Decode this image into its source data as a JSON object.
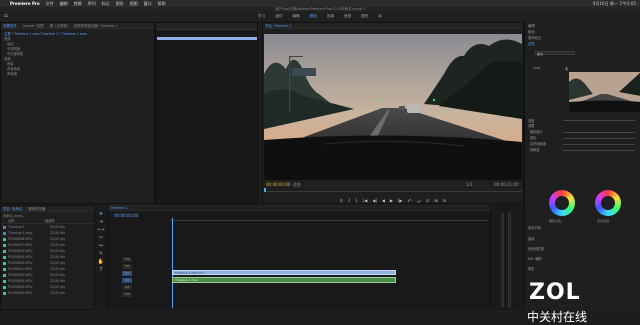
{
  "menubar": {
    "apple": "",
    "app_name": "Premiere Pro",
    "items": [
      "文件",
      "编辑",
      "剪辑",
      "序列",
      "标记",
      "图形",
      "视图",
      "窗口",
      "帮助"
    ],
    "status_right": "9月16日 周一 下午5:05"
  },
  "title_path": "/用户/zol/文稿/Adobe/Premiere Pro/13.0/未命名.prproj *",
  "workspaces": [
    "学习",
    "组件",
    "编辑",
    "颜色",
    "效果",
    "音频",
    "图形",
    "库"
  ],
  "workspace_active": 3,
  "source_panel": {
    "tabs": [
      "效果控件",
      "Lumetri 范围",
      "源: (无剪辑)",
      "音频剪辑混合器: Timeline 1"
    ],
    "rows": [
      "主要 * Timeline 1.mov  Timeline 1 * Timeline 1.mov",
      "视频",
      "运动",
      "不透明度",
      "时间重映射",
      "音频",
      "音量",
      "声道音量",
      "声像器"
    ]
  },
  "program": {
    "tab": "节目: Timeline 1",
    "timecode_left": "00:00:00:00",
    "fit": "适合",
    "quality": "1/2",
    "timecode_right": "00:00:21:00"
  },
  "controls": [
    "⚲",
    "{",
    "}",
    "|◀",
    "◀|",
    "◀",
    "▶",
    "|▶",
    "⤺",
    "⤻",
    "⊡",
    "⊞",
    "⊟"
  ],
  "lumetri": {
    "tabs": [
      "编辑",
      "颜色"
    ],
    "rows": [
      "基本校正",
      "创意",
      "曲线",
      "色轮和匹配",
      "HSL 辅助",
      "晕影"
    ],
    "preset_label": "Look",
    "preset_value": "无",
    "sliders": [
      "强度",
      "调整",
      "褪色胶片",
      "锐化",
      "自然饱和度",
      "饱和度"
    ],
    "wheel_labels": [
      "阴影淡色",
      "高光色调"
    ],
    "balance_label": "色彩平衡"
  },
  "project": {
    "tabs": [
      "项目: 未命名",
      "媒体浏览器"
    ],
    "path": "未命名.prproj",
    "columns": [
      "名称",
      "帧速率"
    ],
    "items": [
      {
        "name": "Timeline 1",
        "rate": "25.00 fps"
      },
      {
        "name": "Timeline 1.mov",
        "rate": "25.00 fps"
      },
      {
        "name": "P1000836.MOV",
        "rate": "25.00 fps"
      },
      {
        "name": "P1000837.MOV",
        "rate": "25.00 fps"
      },
      {
        "name": "P1000838.MOV",
        "rate": "25.00 fps"
      },
      {
        "name": "P1000839.MOV",
        "rate": "25.00 fps"
      },
      {
        "name": "P1000840.MOV",
        "rate": "25.00 fps"
      },
      {
        "name": "P1000841.MOV",
        "rate": "25.00 fps"
      },
      {
        "name": "P1000842.MOV",
        "rate": "25.00 fps"
      },
      {
        "name": "P1000843.MOV",
        "rate": "25.00 fps"
      },
      {
        "name": "P1000844.MOV",
        "rate": "25.00 fps"
      },
      {
        "name": "P1000845.MOV",
        "rate": "25.00 fps"
      }
    ]
  },
  "timeline": {
    "tab": "Timeline 1",
    "timecode": "00:00:00:00",
    "tracks": [
      "V3",
      "V2",
      "V1",
      "A1",
      "A2",
      "A3"
    ],
    "clip_video": "Timeline 1.mov [V]",
    "clip_audio": "Timeline 1.mov"
  },
  "watermark": {
    "logo": "ZOL",
    "tagline": "中关村在线"
  }
}
